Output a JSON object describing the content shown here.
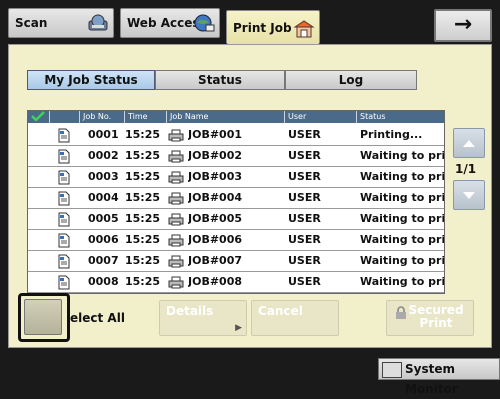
{
  "top_tabs": [
    {
      "label": "Scan",
      "icon": "scanner-icon"
    },
    {
      "label": "Web Access",
      "icon": "globe-icon"
    },
    {
      "label": "Print Job",
      "icon": "printer-tab-icon"
    }
  ],
  "arrow_label": "→",
  "sub_tabs": [
    "My Job Status",
    "Status",
    "Log"
  ],
  "table": {
    "headers": [
      "Job No.",
      "Time",
      "Job Name",
      "User",
      "Status"
    ],
    "rows": [
      {
        "no": "0001",
        "time": "15:25",
        "name": "JOB#001",
        "user": "USER",
        "status": "Printing..."
      },
      {
        "no": "0002",
        "time": "15:25",
        "name": "JOB#002",
        "user": "USER",
        "status": "Waiting to print."
      },
      {
        "no": "0003",
        "time": "15:25",
        "name": "JOB#003",
        "user": "USER",
        "status": "Waiting to print."
      },
      {
        "no": "0004",
        "time": "15:25",
        "name": "JOB#004",
        "user": "USER",
        "status": "Waiting to print."
      },
      {
        "no": "0005",
        "time": "15:25",
        "name": "JOB#005",
        "user": "USER",
        "status": "Waiting to print."
      },
      {
        "no": "0006",
        "time": "15:25",
        "name": "JOB#006",
        "user": "USER",
        "status": "Waiting to print."
      },
      {
        "no": "0007",
        "time": "15:25",
        "name": "JOB#007",
        "user": "USER",
        "status": "Waiting to print."
      },
      {
        "no": "0008",
        "time": "15:25",
        "name": "JOB#008",
        "user": "USER",
        "status": "Waiting to print."
      }
    ]
  },
  "page_indicator": "1/1",
  "buttons": {
    "select_all": "elect All",
    "details": "Details",
    "cancel": "Cancel",
    "secured_print_line1": "Secured",
    "secured_print_line2": "Print"
  },
  "system_monitor": "System Monitor",
  "colors": {
    "panel": "#f2efcb",
    "header": "#4b6a8a",
    "active_tab": "#a9c9e8",
    "check": "#1e9a3a"
  }
}
